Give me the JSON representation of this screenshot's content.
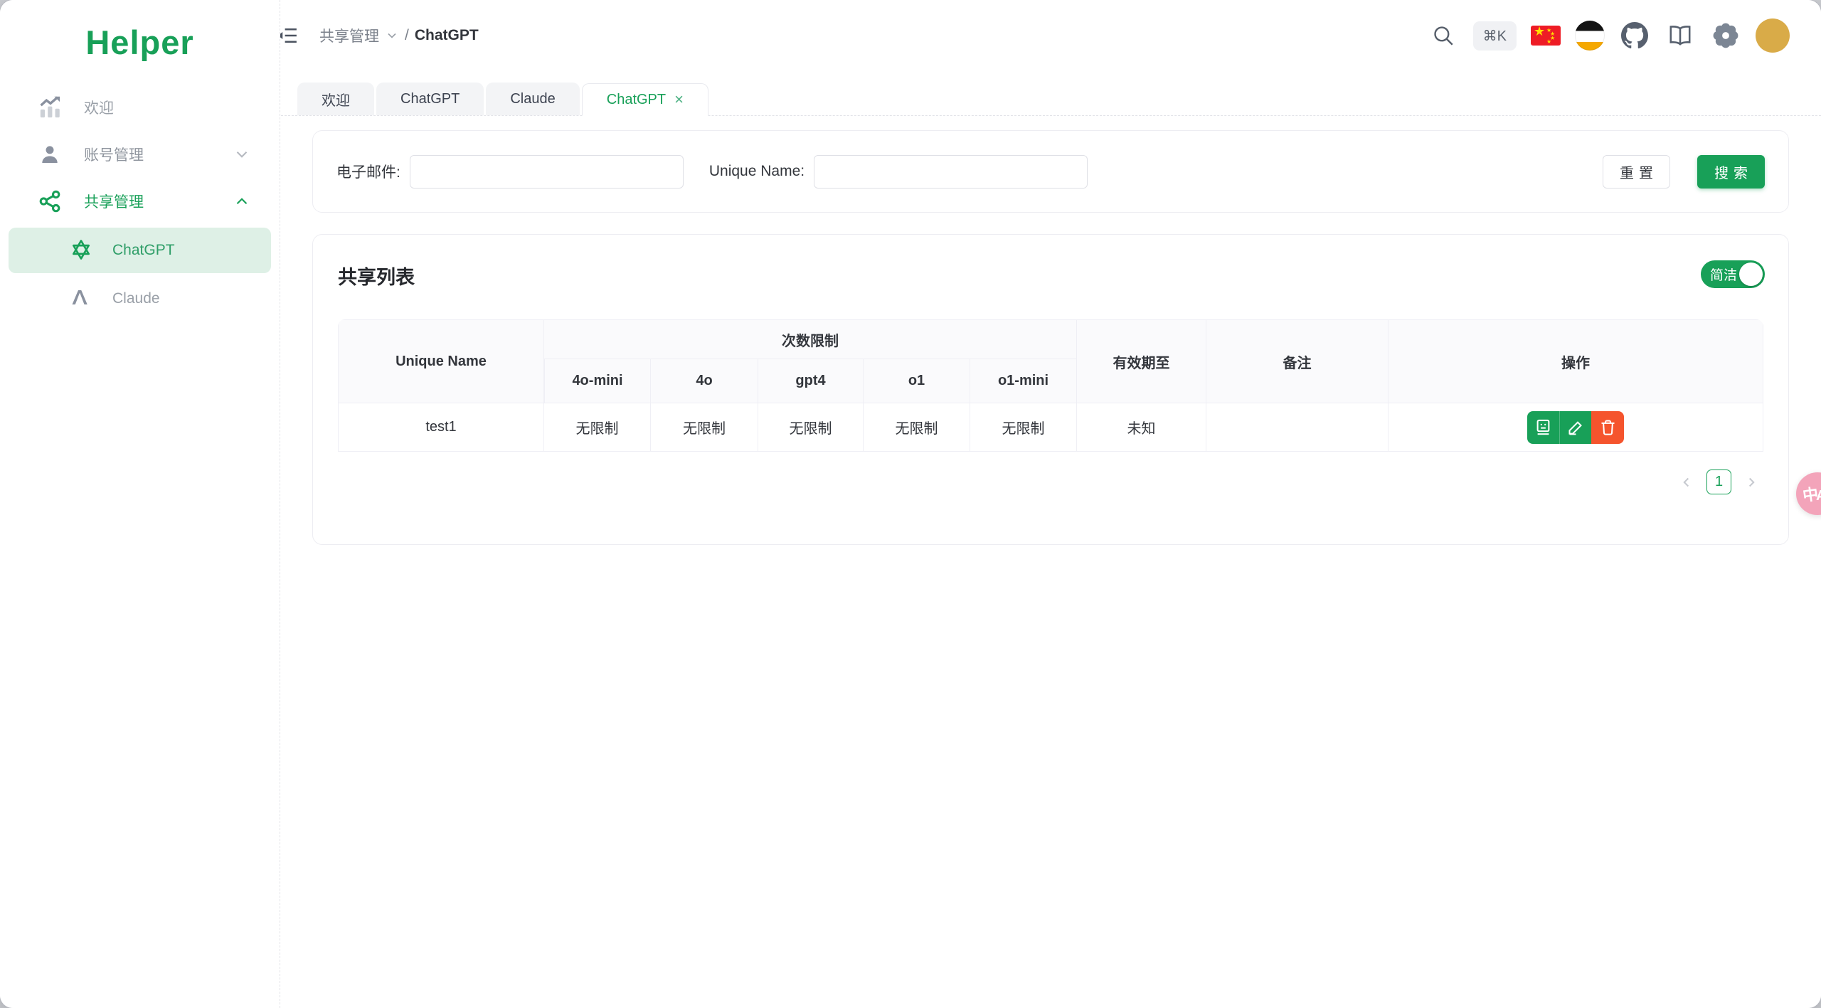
{
  "app": {
    "logo": "Helper"
  },
  "sidebar": {
    "items": [
      {
        "label": "欢迎"
      },
      {
        "label": "账号管理"
      },
      {
        "label": "共享管理"
      }
    ],
    "children": [
      {
        "label": "ChatGPT"
      },
      {
        "label": "Claude"
      }
    ]
  },
  "header": {
    "breadcrumb_parent": "共享管理",
    "breadcrumb_separator": "/",
    "breadcrumb_current": "ChatGPT",
    "shortcut_badge": "⌘K",
    "flag_star": "★"
  },
  "tabs": [
    {
      "label": "欢迎"
    },
    {
      "label": "ChatGPT"
    },
    {
      "label": "Claude"
    },
    {
      "label": "ChatGPT",
      "close": "×"
    }
  ],
  "search_form": {
    "email_label": "电子邮件:",
    "email_value": "",
    "unique_label": "Unique Name:",
    "unique_value": "",
    "reset": "重置",
    "search": "搜索"
  },
  "share_list": {
    "title": "共享列表",
    "toggle_label": "简洁",
    "toggle_state": "on",
    "table": {
      "col_unique": "Unique Name",
      "col_limits": "次数限制",
      "limit_cols": [
        "4o-mini",
        "4o",
        "gpt4",
        "o1",
        "o1-mini"
      ],
      "col_expiry": "有效期至",
      "col_note": "备注",
      "col_actions": "操作",
      "rows": [
        {
          "unique": "test1",
          "limits": [
            "无限制",
            "无限制",
            "无限制",
            "无限制",
            "无限制"
          ],
          "expiry": "未知",
          "note": ""
        }
      ]
    },
    "pagination": {
      "page": "1"
    }
  },
  "floating": {
    "zh": "中",
    "en": "A"
  },
  "colors": {
    "primary": "#18a058",
    "danger": "#f5542d",
    "selected_bg": "#def0e6",
    "pink": "#f3a4ba"
  }
}
